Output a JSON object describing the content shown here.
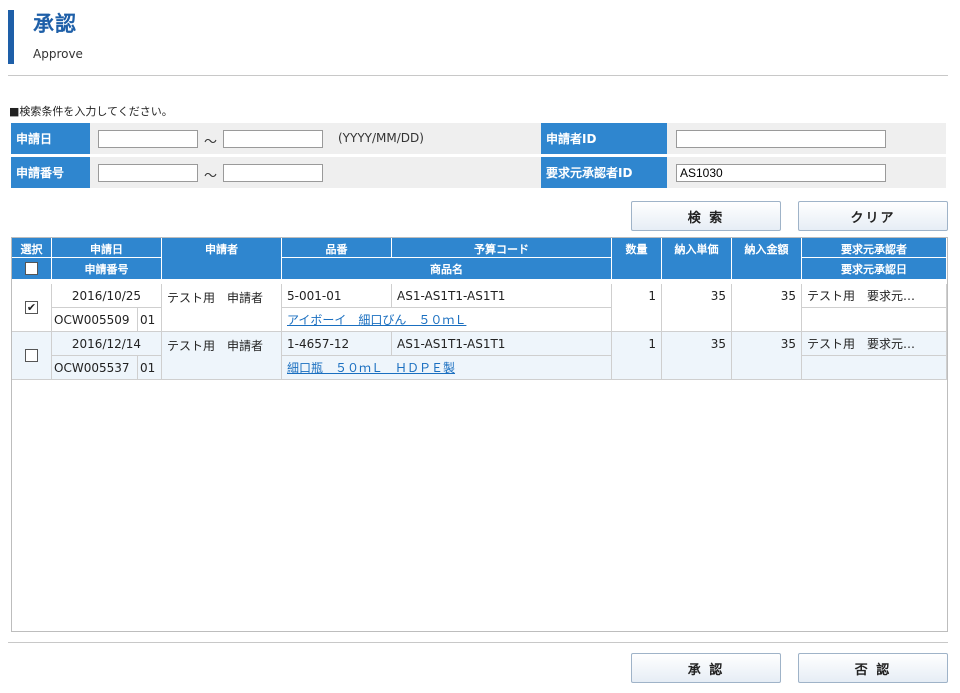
{
  "header": {
    "title": "承認",
    "subtitle": "Approve"
  },
  "search": {
    "hint": "■検索条件を入力してください。",
    "apply_date_label": "申請日",
    "apply_date_from": "",
    "apply_date_to": "",
    "tilde": "～",
    "date_format": "(YYYY/MM/DD)",
    "apply_no_label": "申請番号",
    "apply_no_from": "",
    "apply_no_to": "",
    "applicant_id_label": "申請者ID",
    "applicant_id_value": "",
    "requester_approver_id_label": "要求元承認者ID",
    "requester_approver_id_value": "AS1030",
    "search_button": "検 索",
    "clear_button": "クリア"
  },
  "grid": {
    "headers": {
      "select": "選択",
      "apply_date": "申請日",
      "apply_no": "申請番号",
      "applicant": "申請者",
      "part_no": "品番",
      "budget_code": "予算コード",
      "product_name": "商品名",
      "quantity": "数量",
      "unit_price": "納入単価",
      "amount": "納入金額",
      "requester_approver": "要求元承認者",
      "requester_approval_date": "要求元承認日"
    },
    "rows": [
      {
        "checked": true,
        "check_mark": "✔",
        "apply_date": "2016/10/25",
        "apply_no": "OCW005509",
        "apply_seq": "01",
        "applicant": "テスト用　申請者",
        "part_no": "5-001-01",
        "budget_code": "AS1-AS1T1-AS1T1",
        "product_name": "アイボーイ　細口びん　５０ｍＬ",
        "quantity": "1",
        "unit_price": "35",
        "amount": "35",
        "requester_approver": "テスト用　要求元…",
        "requester_approval_date": ""
      },
      {
        "checked": false,
        "check_mark": "",
        "apply_date": "2016/12/14",
        "apply_no": "OCW005537",
        "apply_seq": "01",
        "applicant": "テスト用　申請者",
        "part_no": "1-4657-12",
        "budget_code": "AS1-AS1T1-AS1T1",
        "product_name": "細口瓶　５０ｍＬ　ＨＤＰＥ製",
        "quantity": "1",
        "unit_price": "35",
        "amount": "35",
        "requester_approver": "テスト用　要求元…",
        "requester_approval_date": ""
      }
    ]
  },
  "footer": {
    "approve_button": "承 認",
    "reject_button": "否 認"
  },
  "colors": {
    "accent": "#2f86cf",
    "title": "#1e5fa8",
    "link": "#1a6fc0"
  }
}
